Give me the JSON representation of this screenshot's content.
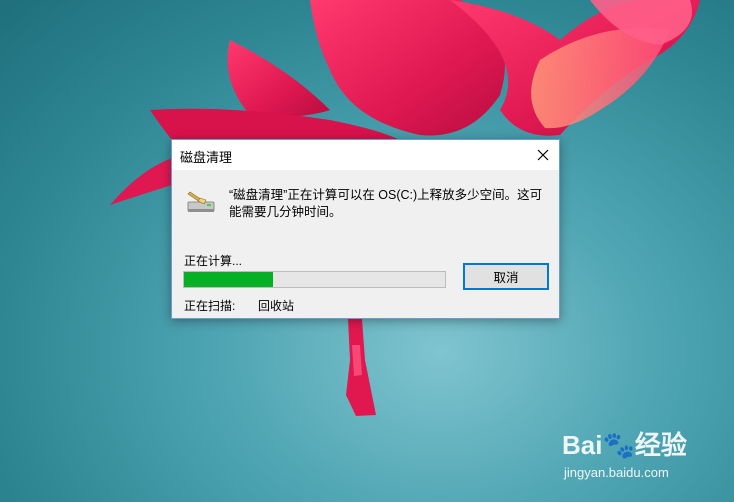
{
  "dialog": {
    "title": "磁盘清理",
    "message": "“磁盘清理”正在计算可以在 OS(C:)上释放多少空间。这可能需要几分钟时间。",
    "status": "正在计算...",
    "progress": 0.34,
    "cancel_label": "取消",
    "scan_label": "正在扫描:",
    "scan_value": "回收站"
  },
  "watermark": {
    "logo_text": "Bai🐾经验",
    "url": "jingyan.baidu.com"
  },
  "colors": {
    "progress_fill": "#06b025",
    "button_border": "#0078d7",
    "dialog_border": "#6f9bc8"
  },
  "icons": {
    "close": "close-icon",
    "app": "disk-cleanup-icon"
  }
}
